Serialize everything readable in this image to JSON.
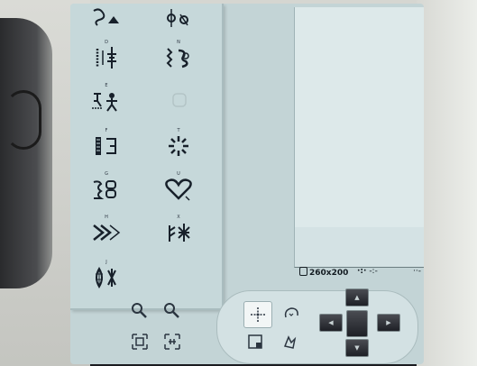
{
  "info": {
    "hoop_size": "260x200",
    "hoop_icon": "hoop-frame-icon",
    "center_readout": "-:-",
    "dots_readout": "··-"
  },
  "stitch_panel": {
    "items": [
      {
        "letter": "",
        "icon": "stitch-serif-s-icon"
      },
      {
        "letter": "",
        "icon": "stitch-flourish-icon"
      },
      {
        "letter": "D",
        "icon": "stitch-ladder-icon"
      },
      {
        "letter": "N",
        "icon": "stitch-zigzag-loop-icon"
      },
      {
        "letter": "E",
        "icon": "stitch-figure-icon"
      },
      {
        "letter": "",
        "icon": "stitch-empty-slot"
      },
      {
        "letter": "F",
        "icon": "stitch-satin-bar-icon"
      },
      {
        "letter": "T",
        "icon": "stitch-starburst-icon"
      },
      {
        "letter": "G",
        "icon": "stitch-knot-icon"
      },
      {
        "letter": "U",
        "icon": "stitch-heart-icon"
      },
      {
        "letter": "H",
        "icon": "stitch-chevron-icon"
      },
      {
        "letter": "X",
        "icon": "stitch-snowflake-icon"
      },
      {
        "letter": "J",
        "icon": "stitch-leaf-icon"
      }
    ]
  },
  "right_toolbar": {
    "icons": [
      "zoom-fit-icon",
      "pencil-icon",
      "arrow-up-icon",
      "arrow-left-icon",
      "page-icon",
      "clock-icon"
    ]
  },
  "bottom_controls": {
    "zoom_in_icon": "zoom-in-icon",
    "zoom_out_icon": "zoom-out-icon",
    "fit_icon": "fit-screen-icon",
    "grid_icon": "grid-toggle-icon",
    "move_icon": "move-crosshair-icon",
    "rotate_icon": "rotate-icon",
    "frame_icon": "frame-outline-icon",
    "pan_icon": "pan-hand-icon",
    "dpad": [
      "dpad-up",
      "dpad-left",
      "dpad-center",
      "dpad-right",
      "dpad-down"
    ]
  },
  "colors": {
    "screen_bg": "#c3d4d6",
    "panel_bg": "#c6d8da",
    "canvas_bg": "#dde9ea",
    "dpad": "#26282d"
  }
}
